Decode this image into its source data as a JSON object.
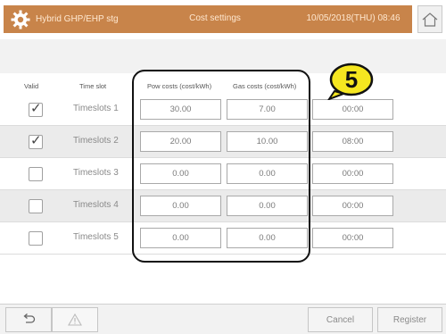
{
  "header": {
    "app_title": "Hybrid GHP/EHP stg",
    "screen_title": "Cost settings",
    "datetime": "10/05/2018(THU) 08:46",
    "home_icon": "home-icon",
    "settings_icon": "gear-icon"
  },
  "table": {
    "columns": {
      "valid": "Valid",
      "timeslot": "Time slot",
      "pow_costs": "Pow costs (cost/kWh)",
      "gas_costs": "Gas costs (cost/kWh)"
    },
    "rows": [
      {
        "valid": true,
        "label": "Timeslots 1",
        "pow": "30.00",
        "gas": "7.00",
        "time": "00:00"
      },
      {
        "valid": true,
        "label": "Timeslots 2",
        "pow": "20.00",
        "gas": "10.00",
        "time": "08:00"
      },
      {
        "valid": false,
        "label": "Timeslots 3",
        "pow": "0.00",
        "gas": "0.00",
        "time": "00:00"
      },
      {
        "valid": false,
        "label": "Timeslots 4",
        "pow": "0.00",
        "gas": "0.00",
        "time": "00:00"
      },
      {
        "valid": false,
        "label": "Timeslots 5",
        "pow": "0.00",
        "gas": "0.00",
        "time": "00:00"
      }
    ]
  },
  "annotation": {
    "number": "5"
  },
  "footer": {
    "back_icon": "back-arrow-icon",
    "warning_icon": "warning-icon",
    "cancel": "Cancel",
    "register": "Register"
  },
  "colors": {
    "titlebar": "#c8844a",
    "title_text": "#ffe8d0",
    "badge": "#f5e620"
  }
}
